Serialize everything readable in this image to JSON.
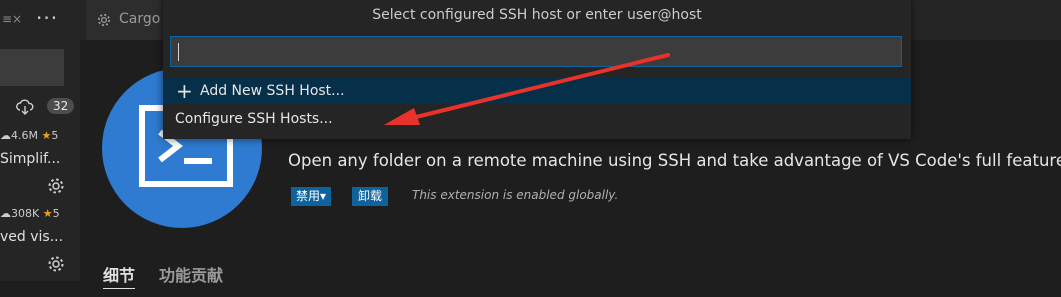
{
  "sidebar": {
    "badge": "32",
    "extensions": [
      {
        "downloads": "4.6M",
        "rating": "5",
        "name": "Simplif..."
      },
      {
        "downloads": "308K",
        "rating": "5",
        "name": "ved vis..."
      }
    ]
  },
  "tab": {
    "label": "Cargo"
  },
  "extension_page": {
    "description": "Open any folder on a remote machine using SSH and take advantage of VS Code's full feature set.",
    "disable_button": "禁用▾",
    "uninstall_button": "卸载",
    "enabled_note": "This extension is enabled globally.",
    "tabs": [
      "细节",
      "功能贡献"
    ]
  },
  "quick_pick": {
    "title": "Select configured SSH host or enter user@host",
    "input_value": "",
    "items": [
      "Add New SSH Host...",
      "Configure SSH Hosts..."
    ]
  },
  "colors": {
    "accent": "#0e639c",
    "selection": "#062f4a",
    "annotation_arrow": "#e8322b",
    "star": "#e8a317",
    "extension_icon": "#2f7bd1"
  }
}
